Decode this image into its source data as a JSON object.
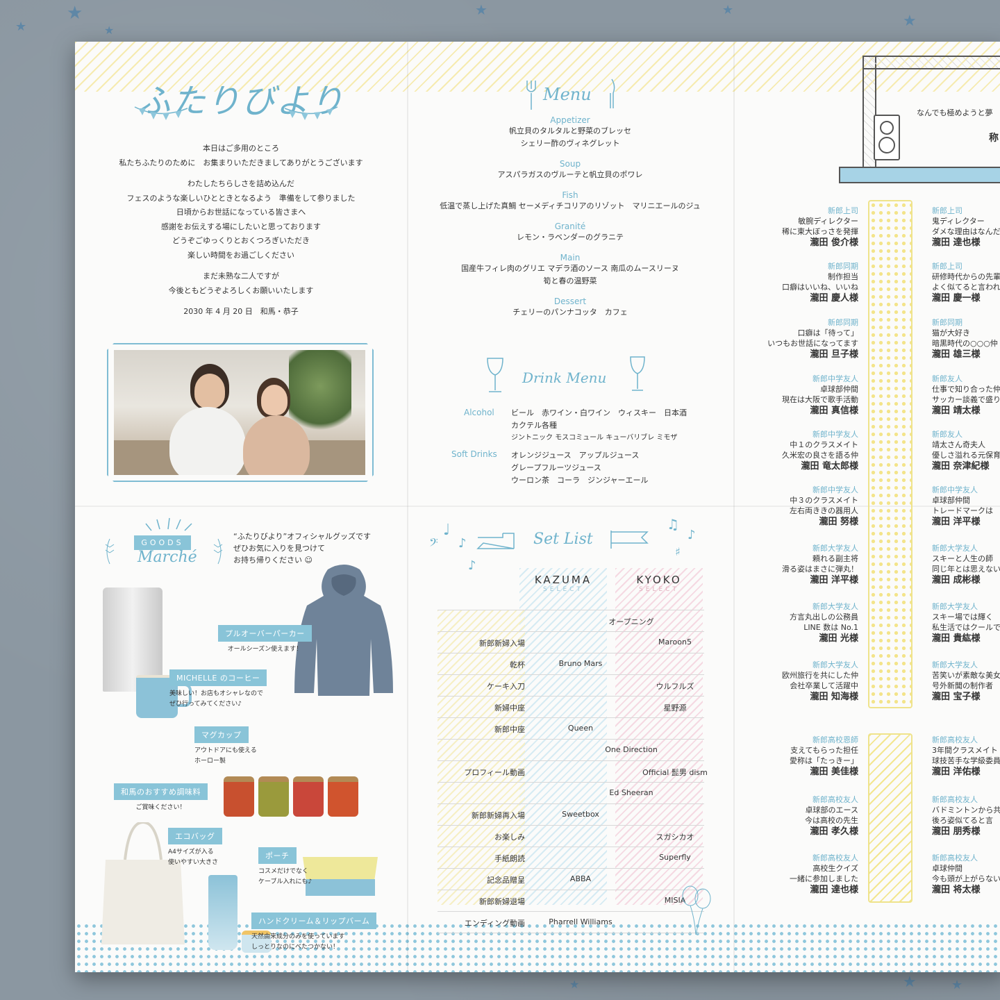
{
  "welcome": {
    "logo": "ふたりびより",
    "lines1": [
      "本日はご多用のところ",
      "私たちふたりのために　お集まりいただきましてありがとうございます"
    ],
    "lines2": [
      "わたしたちらしさを詰め込んだ",
      "フェスのような楽しいひとときとなるよう　準備をして参りました",
      "日頃からお世話になっている皆さまへ",
      "感謝をお伝えする場にしたいと思っております",
      "どうぞごゆっくりとおくつろぎいただき",
      "楽しい時間をお過ごしください"
    ],
    "lines3": [
      "まだ未熟な二人ですが",
      "今後ともどうぞよろしくお願いいたします"
    ],
    "date": "2030 年 4 月 20 日　和馬・恭子"
  },
  "menu": {
    "title": "Menu",
    "courses": [
      {
        "cat": "Appetizer",
        "dish": [
          "帆立貝のタルタルと野菜のブレッセ",
          "シェリー酢のヴィネグレット"
        ]
      },
      {
        "cat": "Soup",
        "dish": [
          "アスパラガスのヴルーテと帆立貝のポワレ"
        ]
      },
      {
        "cat": "Fish",
        "dish": [
          "低温で蒸し上げた真鯛 セーメディチコリアのリゾット　マリニエールのジュ"
        ]
      },
      {
        "cat": "Granité",
        "dish": [
          "レモン・ラベンダーのグラニテ"
        ]
      },
      {
        "cat": "Main",
        "dish": [
          "国産牛フィレ肉のグリエ マデラ酒のソース 南瓜のムースリーヌ",
          "筍と春の温野菜"
        ]
      },
      {
        "cat": "Dessert",
        "dish": [
          "チェリーのパンナコッタ　カフェ"
        ]
      }
    ],
    "drink_title": "Drink Menu",
    "alcohol_label": "Alcohol",
    "alcohol": [
      "ビール　赤ワイン・白ワイン　ウィスキー　日本酒",
      "カクテル各種",
      "ジントニック モスコミュール キューバリブレ ミモザ"
    ],
    "soft_label": "Soft Drinks",
    "soft": [
      "オレンジジュース　アップルジュース",
      "グレープフルーツジュース",
      "ウーロン茶　コーラ　ジンジャーエール"
    ]
  },
  "goods": {
    "tag": "GOODS",
    "title": "Marché",
    "intro": [
      "“ふたりびより”オフィシャルグッズです",
      "ぜひお気に入りを見つけて",
      "お持ち帰りください ☺"
    ],
    "items": [
      {
        "label": "プルオーバーパーカー",
        "desc": [
          "オールシーズン使えます！"
        ]
      },
      {
        "label": "MICHELLE のコーヒー",
        "desc": [
          "美味しい！お店もオシャレなので",
          "ぜひ行ってみてください♪"
        ]
      },
      {
        "label": "マグカップ",
        "desc": [
          "アウトドアにも使える",
          "ホーロー製"
        ]
      },
      {
        "label": "和馬のおすすめ調味料",
        "desc": [
          "ご賞味ください！"
        ]
      },
      {
        "label": "エコバッグ",
        "desc": [
          "A4サイズが入る",
          "使いやすい大きさ"
        ]
      },
      {
        "label": "ポーチ",
        "desc": [
          "コスメだけでなく",
          "ケーブル入れにも♪"
        ]
      },
      {
        "label": "ハンドクリーム＆リップバーム",
        "desc": [
          "天然由来成分のみを使っています",
          "しっとりなのにべたつかない！"
        ]
      }
    ]
  },
  "setlist": {
    "title": "Set List",
    "kazuma": "KAZUMA",
    "kyoko": "KYOKO",
    "select": "SELECT",
    "rows": [
      {
        "ev": "",
        "k": "",
        "y": "",
        "mid": "オープニング"
      },
      {
        "ev": "新郎新婦入場",
        "k": "",
        "y": "Maroon5",
        "mid": ""
      },
      {
        "ev": "乾杯",
        "k": "Bruno Mars",
        "y": "",
        "mid": ""
      },
      {
        "ev": "ケーキ入刀",
        "k": "",
        "y": "ウルフルズ",
        "mid": ""
      },
      {
        "ev": "新婦中座",
        "k": "",
        "y": "星野源",
        "mid": ""
      },
      {
        "ev": "新郎中座",
        "k": "Queen",
        "y": "",
        "mid": ""
      },
      {
        "ev": "",
        "k": "",
        "y": "",
        "mid": "One Direction"
      },
      {
        "ev": "プロフィール動画",
        "k": "",
        "y": "Official 髭男 dism",
        "mid": ""
      },
      {
        "ev": "",
        "k": "",
        "y": "",
        "mid": "Ed Sheeran"
      },
      {
        "ev": "新郎新婦再入場",
        "k": "Sweetbox",
        "y": "",
        "mid": ""
      },
      {
        "ev": "お楽しみ",
        "k": "",
        "y": "スガシカオ",
        "mid": ""
      },
      {
        "ev": "手紙朗読",
        "k": "",
        "y": "Superfly",
        "mid": ""
      },
      {
        "ev": "記念品贈呈",
        "k": "ABBA",
        "y": "",
        "mid": ""
      },
      {
        "ev": "新郎新婦退場",
        "k": "",
        "y": "MISIA",
        "mid": ""
      },
      {
        "ev": "エンディング動画",
        "k": "Pharrell Williams",
        "y": "",
        "mid": ""
      }
    ]
  },
  "guests": {
    "header_line": "なんでも極めようと夢",
    "header_mark": "称",
    "left": [
      {
        "role": "新郎上司",
        "d": [
          "敏腕ディレクター",
          "稀に東大ぼっさを発揮"
        ],
        "name": "瀧田 俊介様"
      },
      {
        "role": "新郎同期",
        "d": [
          "制作担当",
          "口癖はいいね、いいね"
        ],
        "name": "瀧田 慶人様"
      },
      {
        "role": "新郎同期",
        "d": [
          "口癖は「待って」",
          "いつもお世話になってます"
        ],
        "name": "瀧田 旦子様"
      },
      {
        "role": "新郎中学友人",
        "d": [
          "卓球部仲間",
          "現在は大阪で歌手活動"
        ],
        "name": "瀧田 真信様"
      },
      {
        "role": "新郎中学友人",
        "d": [
          "中１のクラスメイト",
          "久米宏の良さを語る仲"
        ],
        "name": "瀧田 竜太郎様"
      },
      {
        "role": "新郎中学友人",
        "d": [
          "中３のクラスメイト",
          "左右両ききの器用人"
        ],
        "name": "瀧田 努様"
      },
      {
        "role": "新郎大学友人",
        "d": [
          "頼れる副主将",
          "滑る姿はまさに弾丸！"
        ],
        "name": "瀧田 洋平様"
      },
      {
        "role": "新郎大学友人",
        "d": [
          "方言丸出しの公務員",
          "LINE 数は No.1"
        ],
        "name": "瀧田 光様"
      },
      {
        "role": "新郎大学友人",
        "d": [
          "欧州旅行を共にした仲",
          "会社卒業して活躍中"
        ],
        "name": "瀧田 知海様"
      },
      {
        "role": "新郎高校恩師",
        "d": [
          "支えてもらった担任",
          "愛称は「たっきー」"
        ],
        "name": "瀧田 美佳様"
      },
      {
        "role": "新郎高校友人",
        "d": [
          "卓球部のエース",
          "今は高校の先生"
        ],
        "name": "瀧田 孝久様"
      },
      {
        "role": "新郎高校友人",
        "d": [
          "高校生クイズ",
          "一緒に参加しました"
        ],
        "name": "瀧田 達也様"
      }
    ],
    "right": [
      {
        "role": "新郎上司",
        "d": [
          "鬼ディレクター",
          "ダメな理由はなんだ"
        ],
        "name": "瀧田 達也様"
      },
      {
        "role": "新郎上司",
        "d": [
          "研修時代からの先輩",
          "よく似てると言われ"
        ],
        "name": "瀧田 慶一様"
      },
      {
        "role": "新郎同期",
        "d": [
          "猫が大好き",
          "暗黒時代の○○○仲"
        ],
        "name": "瀧田 雄三様"
      },
      {
        "role": "新郎友人",
        "d": [
          "仕事で知り合った仲",
          "サッカー談義で盛り"
        ],
        "name": "瀧田 靖太様"
      },
      {
        "role": "新郎友人",
        "d": [
          "靖太さん奇夫人",
          "優しさ溢れる元保育"
        ],
        "name": "瀧田 奈津紀様"
      },
      {
        "role": "新郎中学友人",
        "d": [
          "卓球部仲間",
          "トレードマークは"
        ],
        "name": "瀧田 洋平様"
      },
      {
        "role": "新郎大学友人",
        "d": [
          "スキーと人生の師",
          "同じ年とは思えない"
        ],
        "name": "瀧田 成彬様"
      },
      {
        "role": "新郎大学友人",
        "d": [
          "スキー場では輝く",
          "私生活ではクールで"
        ],
        "name": "瀧田 貴紘様"
      },
      {
        "role": "新郎大学友人",
        "d": [
          "苦笑いが素敵な美女",
          "号外新聞の制作者"
        ],
        "name": "瀧田 宝子様"
      },
      {
        "role": "新郎高校友人",
        "d": [
          "3年間クラスメイト",
          "球技苦手な学級委員"
        ],
        "name": "瀧田 洋佑様"
      },
      {
        "role": "新郎高校友人",
        "d": [
          "バドミントンから共",
          "後ろ姿似てると言"
        ],
        "name": "瀧田 朋秀様"
      },
      {
        "role": "新郎高校友人",
        "d": [
          "卓球仲間",
          "今も頭が上がらない"
        ],
        "name": "瀧田 将太様"
      }
    ]
  }
}
